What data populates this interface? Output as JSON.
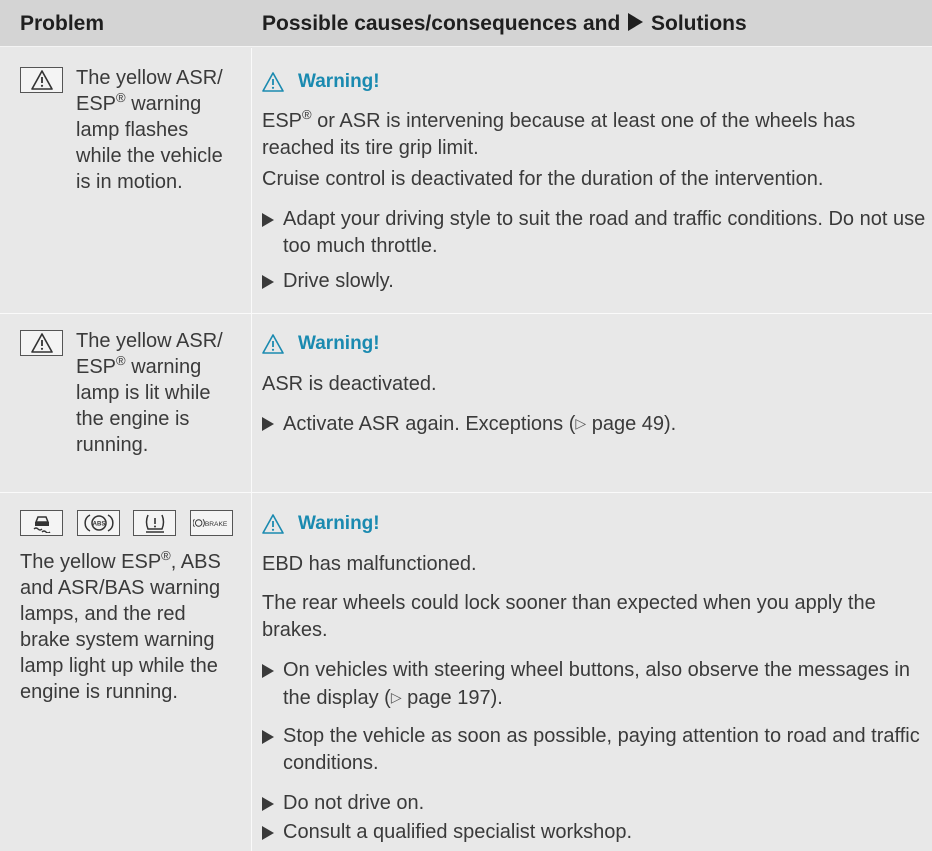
{
  "header": {
    "problem_label": "Problem",
    "solution_label_before": "Possible causes/consequences and",
    "solution_label_after": "Solutions"
  },
  "rows": [
    {
      "symbols": [
        "warning-triangle-lamp"
      ],
      "problem_lines": [
        "The yellow ASR/",
        "ESP",
        "warning",
        "lamp flashes",
        "while the vehicle",
        "is in motion."
      ],
      "problem_sup": "®",
      "warning": "Warning!",
      "paragraphs": [
        {
          "before": "ESP",
          "sup": "®",
          "after": " or ASR is intervening because at least one of the wheels has reached its tire grip limit."
        },
        {
          "text": "Cruise control is deactivated for the duration of the intervention."
        }
      ],
      "bullets": [
        "Adapt your driving style to suit the road and traffic conditions. Do not use too much throttle.",
        "Drive slowly."
      ]
    },
    {
      "symbols": [
        "warning-triangle-lamp"
      ],
      "problem_lines": [
        "The yellow ASR/",
        "ESP",
        "warning",
        "lamp is lit while",
        "the engine is",
        "running."
      ],
      "problem_sup": "®",
      "warning": "Warning!",
      "paragraphs": [
        {
          "text": "ASR is deactivated."
        }
      ],
      "bullets": [
        {
          "before": "Activate ASR again. Exceptions (",
          "ref": "▷",
          "after": " page 49)."
        }
      ]
    },
    {
      "symbols": [
        "esp-skid-lamp",
        "abs-lamp",
        "tire-pressure-lamp",
        "brake-lamp"
      ],
      "brake_label": "BRAKE",
      "abs_label": "ABS",
      "problem_lines": [
        "The yellow ESP",
        ", ABS",
        "and ASR/BAS warning",
        "lamps, and the red",
        "brake system warning",
        "lamp light up while the",
        "engine is running."
      ],
      "problem_sup": "®",
      "warning": "Warning!",
      "paragraphs": [
        {
          "text": "EBD has malfunctioned."
        },
        {
          "text": "The rear wheels could lock sooner than expected when you apply the brakes."
        }
      ],
      "bullets": [
        {
          "before": "On vehicles with steering wheel buttons, also observe the messages in the display (",
          "ref": "▷",
          "after": " page 197)."
        },
        "Stop the vehicle as soon as possible, paying attention to road and traffic conditions.",
        "Do not drive on.",
        "Consult a qualified specialist workshop."
      ]
    }
  ],
  "colors": {
    "header_bg": "#d4d4d4",
    "row_bg": "#e8e8e8",
    "warning_accent": "#1a8ab0",
    "text": "#3a3a3a"
  }
}
